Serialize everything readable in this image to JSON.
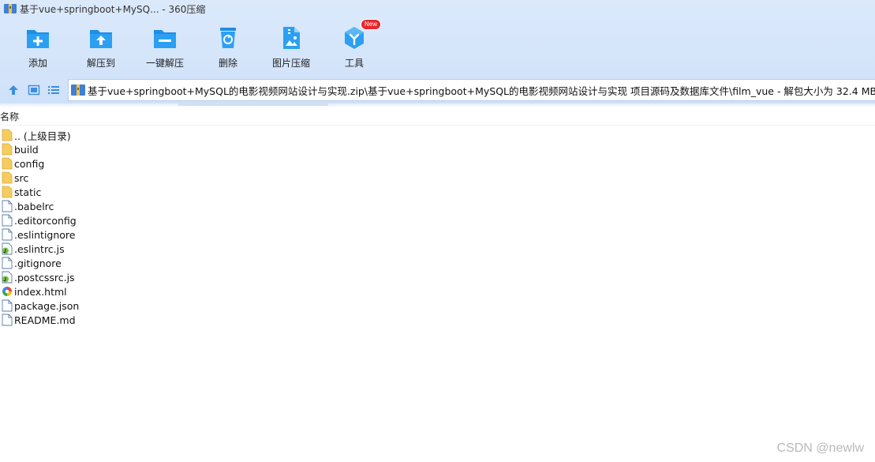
{
  "window": {
    "title": "基于vue+springboot+MySQ... - 360压缩"
  },
  "toolbar": {
    "items": [
      {
        "label": "添加",
        "icon": "add-folder-icon"
      },
      {
        "label": "解压到",
        "icon": "extract-to-icon"
      },
      {
        "label": "一键解压",
        "icon": "one-click-extract-icon"
      },
      {
        "label": "删除",
        "icon": "delete-icon"
      },
      {
        "label": "图片压缩",
        "icon": "image-compress-icon"
      },
      {
        "label": "工具",
        "icon": "tools-icon"
      }
    ],
    "tools_badge": "New"
  },
  "address": {
    "path": "基于vue+springboot+MySQL的电影视频网站设计与实现.zip\\基于vue+springboot+MySQL的电影视频网站设计与实现 项目源码及数据库文件\\film_vue - 解包大小为 32.4 MB"
  },
  "list": {
    "column_name": "名称",
    "files": [
      {
        "name": ".. (上级目录)",
        "type": "folder"
      },
      {
        "name": "build",
        "type": "folder"
      },
      {
        "name": "config",
        "type": "folder"
      },
      {
        "name": "src",
        "type": "folder"
      },
      {
        "name": "static",
        "type": "folder"
      },
      {
        "name": ".babelrc",
        "type": "file"
      },
      {
        "name": ".editorconfig",
        "type": "file"
      },
      {
        "name": ".eslintignore",
        "type": "file"
      },
      {
        "name": ".eslintrc.js",
        "type": "js"
      },
      {
        "name": ".gitignore",
        "type": "file"
      },
      {
        "name": ".postcssrc.js",
        "type": "js"
      },
      {
        "name": "index.html",
        "type": "html"
      },
      {
        "name": "package.json",
        "type": "file"
      },
      {
        "name": "README.md",
        "type": "file"
      }
    ]
  },
  "watermark": "CSDN @newlw",
  "colors": {
    "accent": "#1d8ee6",
    "chrome": "#d6e6fa",
    "folder": "#f5cd5e"
  }
}
